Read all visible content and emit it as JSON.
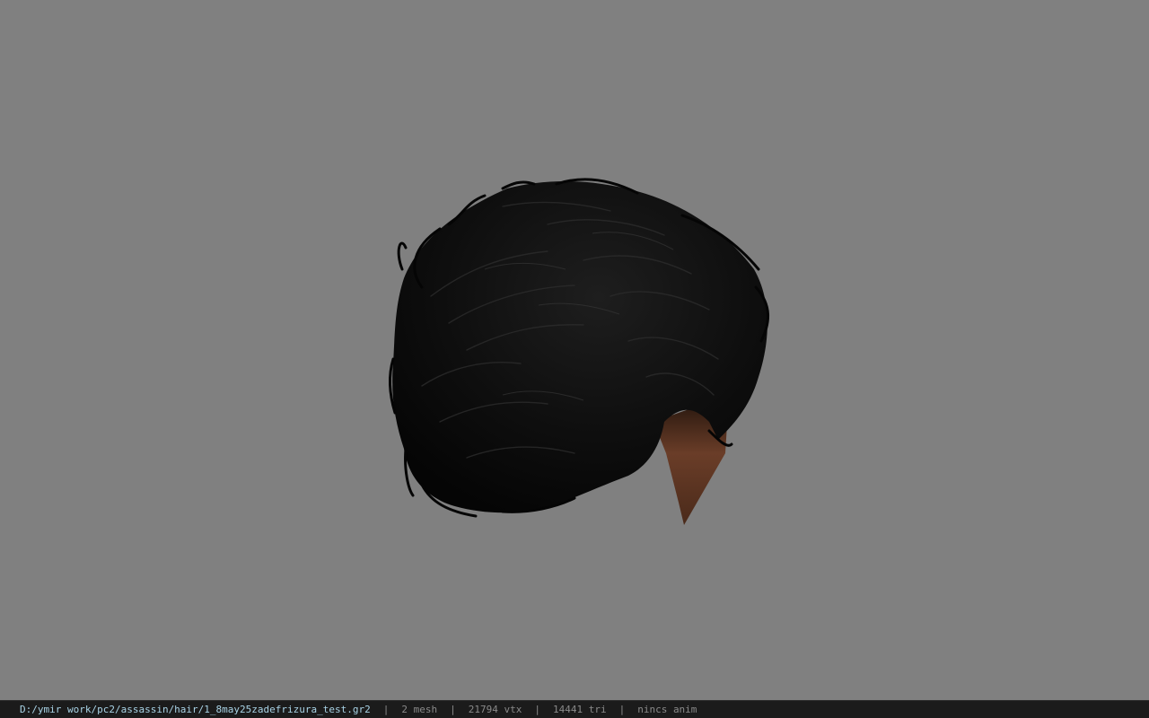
{
  "viewport": {
    "background": "#808080",
    "model": {
      "hair_color": "#0b0b0b",
      "highlight_color": "#2e2e2e",
      "skin_color": "#6a3d28"
    }
  },
  "status_bar": {
    "file_path": "D:/ymir work/pc2/assassin/hair/1_8may25zadefrizura_test.gr2",
    "separator": "|",
    "mesh": "2 mesh",
    "vertices": "21794 vtx",
    "triangles": "14441 tri",
    "animation": "nincs anim"
  }
}
